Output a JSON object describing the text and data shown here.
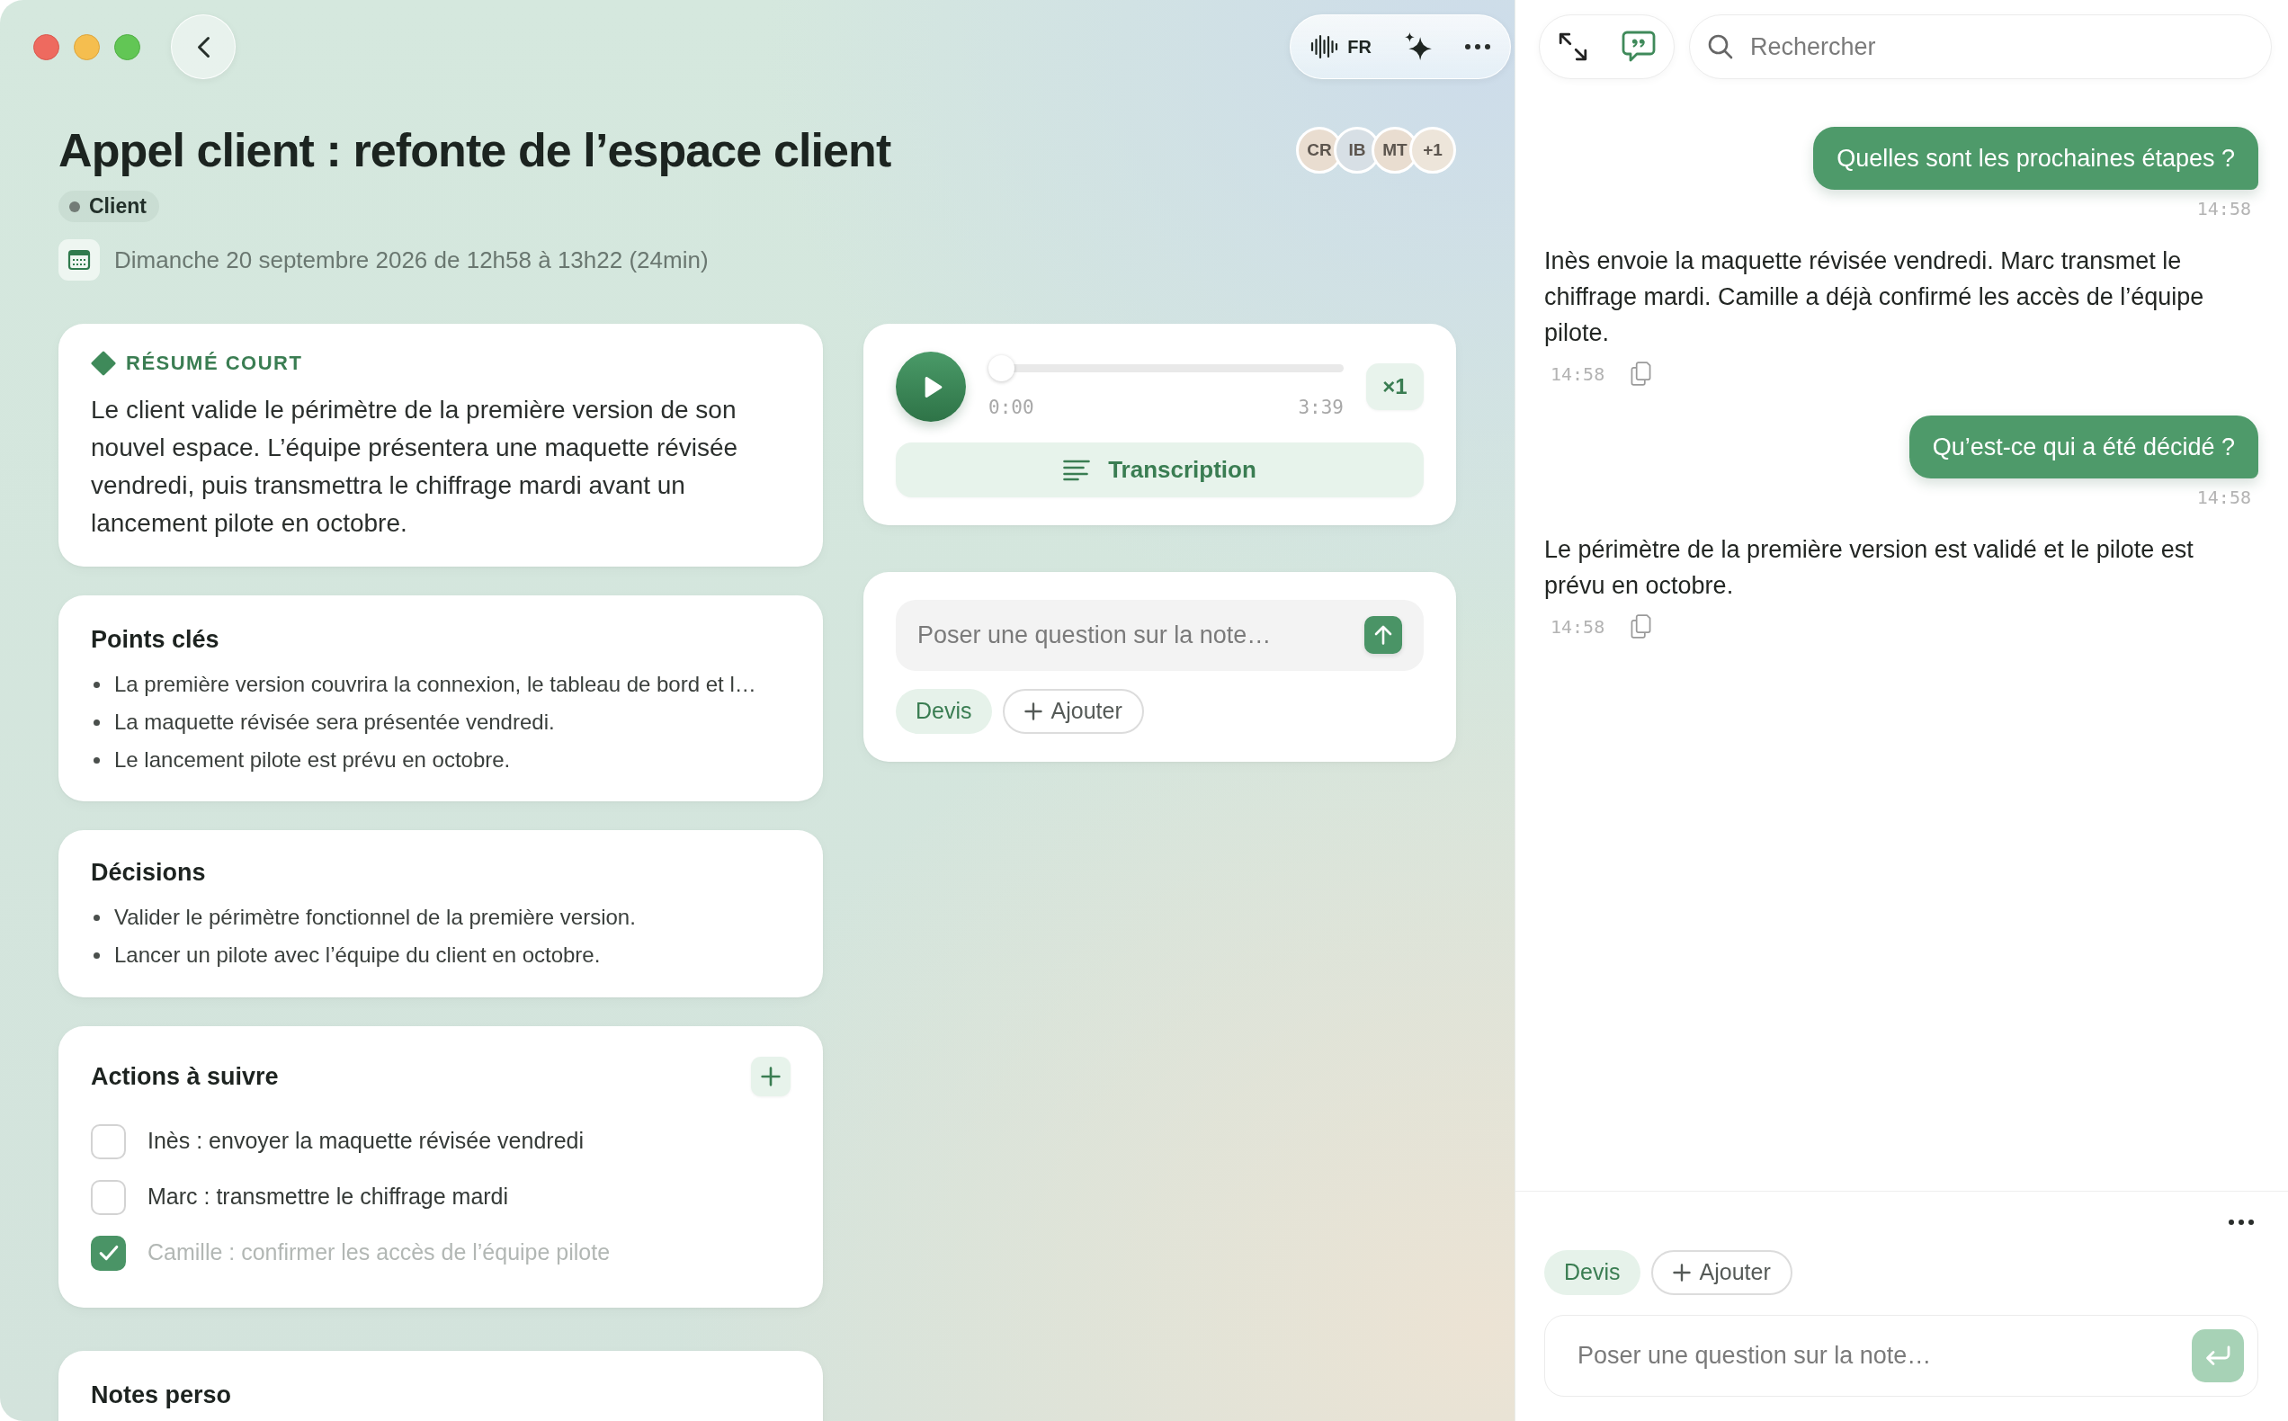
{
  "toolbar": {
    "language": "FR"
  },
  "panel_toolbar": {
    "chat_selected": true
  },
  "search": {
    "placeholder": "Rechercher"
  },
  "note": {
    "title": "Appel client : refonte de l’espace client",
    "participants": [
      {
        "initials": "CR",
        "color": "#e9ddd0"
      },
      {
        "initials": "IB",
        "color": "#d7dfe5"
      },
      {
        "initials": "MT",
        "color": "#e9ddd0"
      }
    ],
    "extra_participants": "+1",
    "tag": "Client",
    "date": "Dimanche 20 septembre 2026 de 12h58 à 13h22 (24min)"
  },
  "summary": {
    "heading": "RÉSUMÉ COURT",
    "text": "Le client valide le périmètre de la première version de son nouvel espace. L’équipe présentera une maquette révisée vendredi, puis transmettra le chiffrage mardi avant un lancement pilote en octobre."
  },
  "sections": [
    {
      "kind": "bullets",
      "title": "Points clés",
      "items": [
        "La première version couvrira la connexion, le tableau de bord et l…",
        "La maquette révisée sera présentée vendredi.",
        "Le lancement pilote est prévu en octobre."
      ]
    },
    {
      "kind": "bullets",
      "title": "Décisions",
      "items": [
        "Valider le périmètre fonctionnel de la première version.",
        "Lancer un pilote avec l’équipe du client en octobre."
      ]
    },
    {
      "kind": "checklist",
      "title": "Actions à suivre",
      "items": [
        {
          "text": "Inès : envoyer la maquette révisée vendredi",
          "checked": false
        },
        {
          "text": "Marc : transmettre le chiffrage mardi",
          "checked": false
        },
        {
          "text": "Camille : confirmer les accès de l’équipe pilote",
          "checked": true
        }
      ]
    },
    {
      "kind": "notes",
      "title": "Notes perso"
    }
  ],
  "player": {
    "level": 0,
    "elapsed": "0:00",
    "duration": "3:39",
    "speed": "×1",
    "transcription": "Transcription"
  },
  "note_question": {
    "placeholder": "Poser une question sur la note…",
    "chips": [
      "Devis"
    ],
    "add_label": "Ajouter"
  },
  "chat": {
    "messages": [
      {
        "kind": "user",
        "text": "Quelles sont les prochaines étapes ?",
        "time": "14:58"
      },
      {
        "kind": "assistant",
        "text": "Inès envoie la maquette révisée vendredi. Marc transmet le chiffrage mardi. Camille a déjà confirmé les accès de l’équipe pilote.",
        "time": "14:58"
      },
      {
        "kind": "user",
        "text": "Qu’est-ce qui a été décidé ?",
        "time": "14:58"
      },
      {
        "kind": "assistant",
        "text": "Le périmètre de la première version est validé et le pilote est prévu en octobre.",
        "time": "14:58"
      }
    ],
    "composer": {
      "chips": [
        "Devis"
      ],
      "add_label": "Ajouter",
      "placeholder": "Poser une question sur la note…",
      "send_disabled": true
    }
  }
}
